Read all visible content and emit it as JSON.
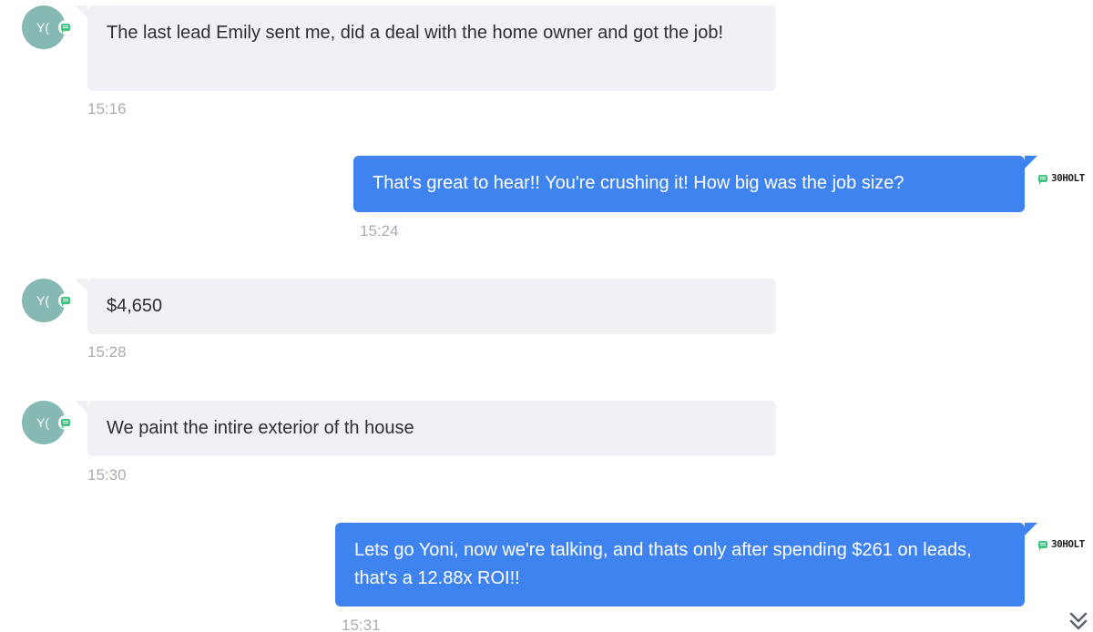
{
  "messages": [
    {
      "direction": "incoming",
      "avatar_initials": "Y(",
      "channel_icon": "sms-icon",
      "text": "The last lead Emily sent me,  did a deal with the home owner and got the job!",
      "time": "15:16"
    },
    {
      "direction": "outgoing",
      "sender_label": "30HOLT",
      "channel_icon": "sms-icon",
      "text": "That's great to hear!! You're crushing it! How big was the job size?",
      "time": "15:24"
    },
    {
      "direction": "incoming",
      "avatar_initials": "Y(",
      "channel_icon": "sms-icon",
      "text": "$4,650",
      "time": "15:28"
    },
    {
      "direction": "incoming",
      "avatar_initials": "Y(",
      "channel_icon": "sms-icon",
      "text": "We paint the intire exterior of th house",
      "time": "15:30"
    },
    {
      "direction": "outgoing",
      "sender_label": "30HOLT",
      "channel_icon": "sms-icon",
      "text": "Lets go Yoni, now we're talking, and thats only after spending $261 on leads, that's a 12.88x ROI!!",
      "time": "15:31"
    }
  ],
  "controls": {
    "scroll_down_icon": "chevron-double-down-icon"
  },
  "colors": {
    "incoming_bubble": "#f0f1f5",
    "outgoing_bubble": "#3f83f0",
    "avatar": "#86b9b3",
    "channel_badge": "#3fc47d",
    "timestamp": "#a8adb5"
  }
}
